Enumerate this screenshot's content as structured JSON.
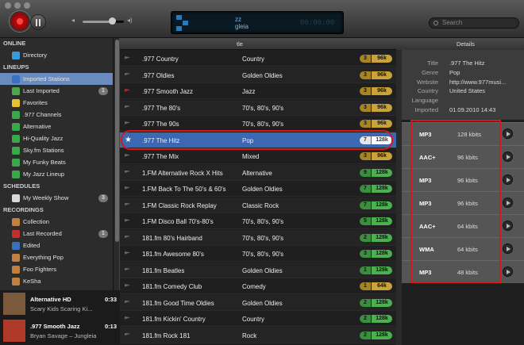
{
  "toolbar": {
    "search_placeholder": "Search",
    "lcd_line1": "zz",
    "lcd_line2": "gleia",
    "lcd_time": "00:00:00",
    "volume_level_pct": 72
  },
  "sidebar": {
    "sections": [
      {
        "title": "ONLINE",
        "items": [
          {
            "label": "Directory",
            "icon": "globe-icon",
            "color": "#3a9ad9"
          }
        ]
      },
      {
        "title": "LINEUPS",
        "items": [
          {
            "label": "Imported Stations",
            "icon": "imported-icon",
            "color": "#3a70c0",
            "selected": true
          },
          {
            "label": "Last Imported",
            "icon": "star-icon",
            "color": "#4aa84a",
            "badge": "1"
          },
          {
            "label": "Favorites",
            "icon": "favorites-icon",
            "color": "#e8c030"
          },
          {
            "label": ".977 Channels",
            "icon": "station-icon",
            "color": "#3aa84a"
          },
          {
            "label": "Alternative",
            "icon": "station-icon",
            "color": "#3aa84a"
          },
          {
            "label": "Hi-Quality Jazz",
            "icon": "station-icon",
            "color": "#3aa84a"
          },
          {
            "label": "Sky.fm Stations",
            "icon": "station-icon",
            "color": "#3aa84a"
          },
          {
            "label": "My Funky Beats",
            "icon": "station-icon",
            "color": "#3aa84a"
          },
          {
            "label": "My Jazz Lineup",
            "icon": "station-icon",
            "color": "#3aa84a"
          }
        ]
      },
      {
        "title": "SCHEDULES",
        "items": [
          {
            "label": "My Weekly Show",
            "icon": "calendar-icon",
            "color": "#d8d8d8",
            "badge": "3"
          }
        ]
      },
      {
        "title": "RECORDINGS",
        "items": [
          {
            "label": "Collection",
            "icon": "collection-icon",
            "color": "#c08040"
          },
          {
            "label": "Last Recorded",
            "icon": "recorded-icon",
            "color": "#c03030",
            "badge": "1"
          },
          {
            "label": "Edited",
            "icon": "edited-icon",
            "color": "#3a70c0"
          },
          {
            "label": "Everything Pop",
            "icon": "smart-icon",
            "color": "#c08040"
          },
          {
            "label": "Foo Fighters",
            "icon": "smart-icon",
            "color": "#c08040"
          },
          {
            "label": "KeSha",
            "icon": "smart-icon",
            "color": "#c08040"
          }
        ]
      }
    ]
  },
  "nowplaying": [
    {
      "title": "Alternative HD",
      "subtitle": "Scary Kids Scaring Ki...",
      "time": "0:33",
      "art": "#7a5a3a"
    },
    {
      "title": ".977 Smooth Jazz",
      "subtitle": "Bryan Savage – Jungleia",
      "time": "0:13",
      "art": "#b03a2a"
    }
  ],
  "list": {
    "header": "tle",
    "rows": [
      {
        "title": ".977 Country",
        "genre": "Country",
        "rank": "3",
        "kbps": "96k",
        "color": "#c9a33a"
      },
      {
        "title": ".977 Oldies",
        "genre": "Golden Oldies",
        "rank": "3",
        "kbps": "96k",
        "color": "#c9a33a"
      },
      {
        "title": ".977 Smooth Jazz",
        "genre": "Jazz",
        "rank": "3",
        "kbps": "96k",
        "color": "#c9a33a",
        "flag": "red"
      },
      {
        "title": ".977 The 80's",
        "genre": "70's, 80's, 90's",
        "rank": "3",
        "kbps": "96k",
        "color": "#c9a33a"
      },
      {
        "title": ".977 The 90s",
        "genre": "70's, 80's, 90's",
        "rank": "3",
        "kbps": "96k",
        "color": "#c9a33a"
      },
      {
        "title": ".977 The Hitz",
        "genre": "Pop",
        "rank": "7",
        "kbps": "128k",
        "color": "#ffffff",
        "selected": true
      },
      {
        "title": ".977 The Mix",
        "genre": "Mixed",
        "rank": "3",
        "kbps": "96k",
        "color": "#c9a33a"
      },
      {
        "title": "1.FM Alternative Rock X Hits",
        "genre": "Alternative",
        "rank": "9",
        "kbps": "128k",
        "color": "#4caf50"
      },
      {
        "title": "1.FM Back To The 50's & 60's",
        "genre": "Golden Oldies",
        "rank": "7",
        "kbps": "128k",
        "color": "#4caf50"
      },
      {
        "title": "1.FM Classic Rock Replay",
        "genre": "Classic Rock",
        "rank": "7",
        "kbps": "128k",
        "color": "#4caf50"
      },
      {
        "title": "1.FM Disco Ball 70's-80's",
        "genre": "70's, 80's, 90's",
        "rank": "5",
        "kbps": "128k",
        "color": "#4caf50"
      },
      {
        "title": "181.fm 80's Hairband",
        "genre": "70's, 80's, 90's",
        "rank": "2",
        "kbps": "128k",
        "color": "#4caf50"
      },
      {
        "title": "181.fm Awesome 80's",
        "genre": "70's, 80's, 90's",
        "rank": "3",
        "kbps": "128k",
        "color": "#4caf50"
      },
      {
        "title": "181.fm Beatles",
        "genre": "Golden Oldies",
        "rank": "1",
        "kbps": "128k",
        "color": "#4caf50"
      },
      {
        "title": "181.fm Comedy Club",
        "genre": "Comedy",
        "rank": "1",
        "kbps": "64k",
        "color": "#c9a33a"
      },
      {
        "title": "181.fm Good Time Oldies",
        "genre": "Golden Oldies",
        "rank": "2",
        "kbps": "128k",
        "color": "#4caf50"
      },
      {
        "title": "181.fm Kickin' Country",
        "genre": "Country",
        "rank": "2",
        "kbps": "128k",
        "color": "#4caf50"
      },
      {
        "title": "181.fm Rock 181",
        "genre": "Rock",
        "rank": "2",
        "kbps": "128k",
        "color": "#4caf50"
      }
    ]
  },
  "details": {
    "header": "Details",
    "info": [
      {
        "label": "Title",
        "value": ".977 The Hitz"
      },
      {
        "label": "Genre",
        "value": "Pop"
      },
      {
        "label": "Website",
        "value": "http://www.977musi..."
      },
      {
        "label": "Country",
        "value": "United States"
      },
      {
        "label": "Language",
        "value": ""
      },
      {
        "label": "Imported",
        "value": "01.09.2010 14:43"
      }
    ],
    "formats": [
      {
        "name": "MP3",
        "kbps": "128 kbits"
      },
      {
        "name": "AAC+",
        "kbps": "96 kbits"
      },
      {
        "name": "MP3",
        "kbps": "96 kbits"
      },
      {
        "name": "MP3",
        "kbps": "96 kbits"
      },
      {
        "name": "AAC+",
        "kbps": "64 kbits"
      },
      {
        "name": "WMA",
        "kbps": "64 kbits"
      },
      {
        "name": "MP3",
        "kbps": "48 kbits"
      }
    ]
  }
}
